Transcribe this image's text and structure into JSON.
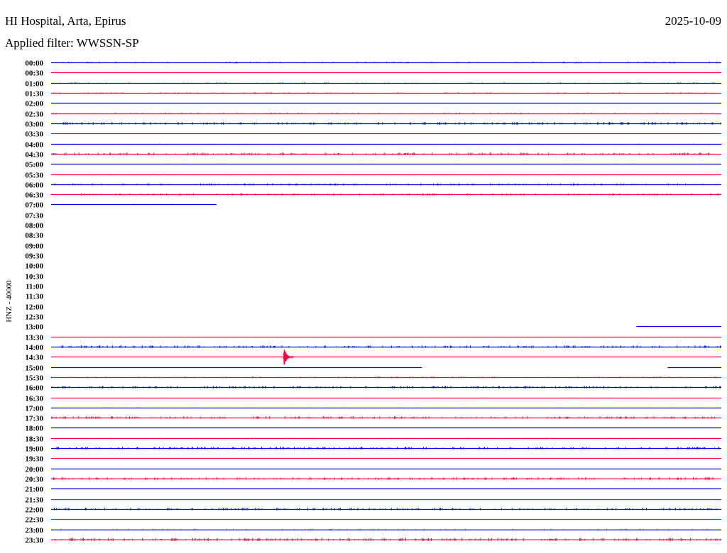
{
  "header": {
    "station": "HI Hospital, Arta, Epirus",
    "date": "2025-10-09",
    "filter": "Applied filter: WWSSN-SP"
  },
  "chart_data": {
    "type": "line",
    "subtype": "helicorder",
    "title": "HI Hospital, Arta, Epirus",
    "date": "2025-10-09",
    "ylabel": "HNZ - 40000",
    "row_minutes": 30,
    "colors": {
      "even": "#0000ee",
      "odd": "#ff0040"
    },
    "rows": [
      {
        "label": "00:00",
        "noise": 1
      },
      {
        "label": "00:30",
        "noise": 0
      },
      {
        "label": "01:00",
        "noise": 1
      },
      {
        "label": "01:30",
        "noise": 1
      },
      {
        "label": "02:00",
        "noise": 0
      },
      {
        "label": "02:30",
        "noise": 1
      },
      {
        "label": "03:00",
        "noise": 2
      },
      {
        "label": "03:30",
        "noise": 0
      },
      {
        "label": "04:00",
        "noise": 0.5
      },
      {
        "label": "04:30",
        "noise": 2
      },
      {
        "label": "05:00",
        "noise": 0.2
      },
      {
        "label": "05:30",
        "noise": 0.5
      },
      {
        "label": "06:00",
        "noise": 1.5
      },
      {
        "label": "06:30",
        "noise": 1.5
      },
      {
        "label": "07:00",
        "noise": 0.3,
        "segments": [
          [
            0,
            7.4
          ]
        ]
      },
      {
        "label": "07:30",
        "segments": []
      },
      {
        "label": "08:00",
        "segments": []
      },
      {
        "label": "08:30",
        "segments": []
      },
      {
        "label": "09:00",
        "segments": []
      },
      {
        "label": "09:30",
        "segments": []
      },
      {
        "label": "10:00",
        "segments": []
      },
      {
        "label": "10:30",
        "segments": []
      },
      {
        "label": "11:00",
        "segments": []
      },
      {
        "label": "11:30",
        "segments": []
      },
      {
        "label": "12:00",
        "segments": []
      },
      {
        "label": "12:30",
        "segments": []
      },
      {
        "label": "13:00",
        "noise": 0,
        "segments": [
          [
            26.2,
            30
          ]
        ]
      },
      {
        "label": "13:30",
        "noise": 0
      },
      {
        "label": "14:00",
        "noise": 2
      },
      {
        "label": "14:30",
        "noise": 0,
        "event": {
          "minute": 10.4,
          "amplitude": 1
        }
      },
      {
        "label": "15:00",
        "noise": 0,
        "segments": [
          [
            0,
            16.6
          ],
          [
            27.6,
            30
          ]
        ]
      },
      {
        "label": "15:30",
        "noise": 1
      },
      {
        "label": "16:00",
        "noise": 2
      },
      {
        "label": "16:30",
        "noise": 0.3
      },
      {
        "label": "17:00",
        "noise": 0.3
      },
      {
        "label": "17:30",
        "noise": 2
      },
      {
        "label": "18:00",
        "noise": 0
      },
      {
        "label": "18:30",
        "noise": 0.5
      },
      {
        "label": "19:00",
        "noise": 2
      },
      {
        "label": "19:30",
        "noise": 0
      },
      {
        "label": "20:00",
        "noise": 0
      },
      {
        "label": "20:30",
        "noise": 2
      },
      {
        "label": "21:00",
        "noise": 0
      },
      {
        "label": "21:30",
        "noise": 0
      },
      {
        "label": "22:00",
        "noise": 2
      },
      {
        "label": "22:30",
        "noise": 0
      },
      {
        "label": "23:00",
        "noise": 1
      },
      {
        "label": "23:30",
        "noise": 2.5
      }
    ]
  }
}
